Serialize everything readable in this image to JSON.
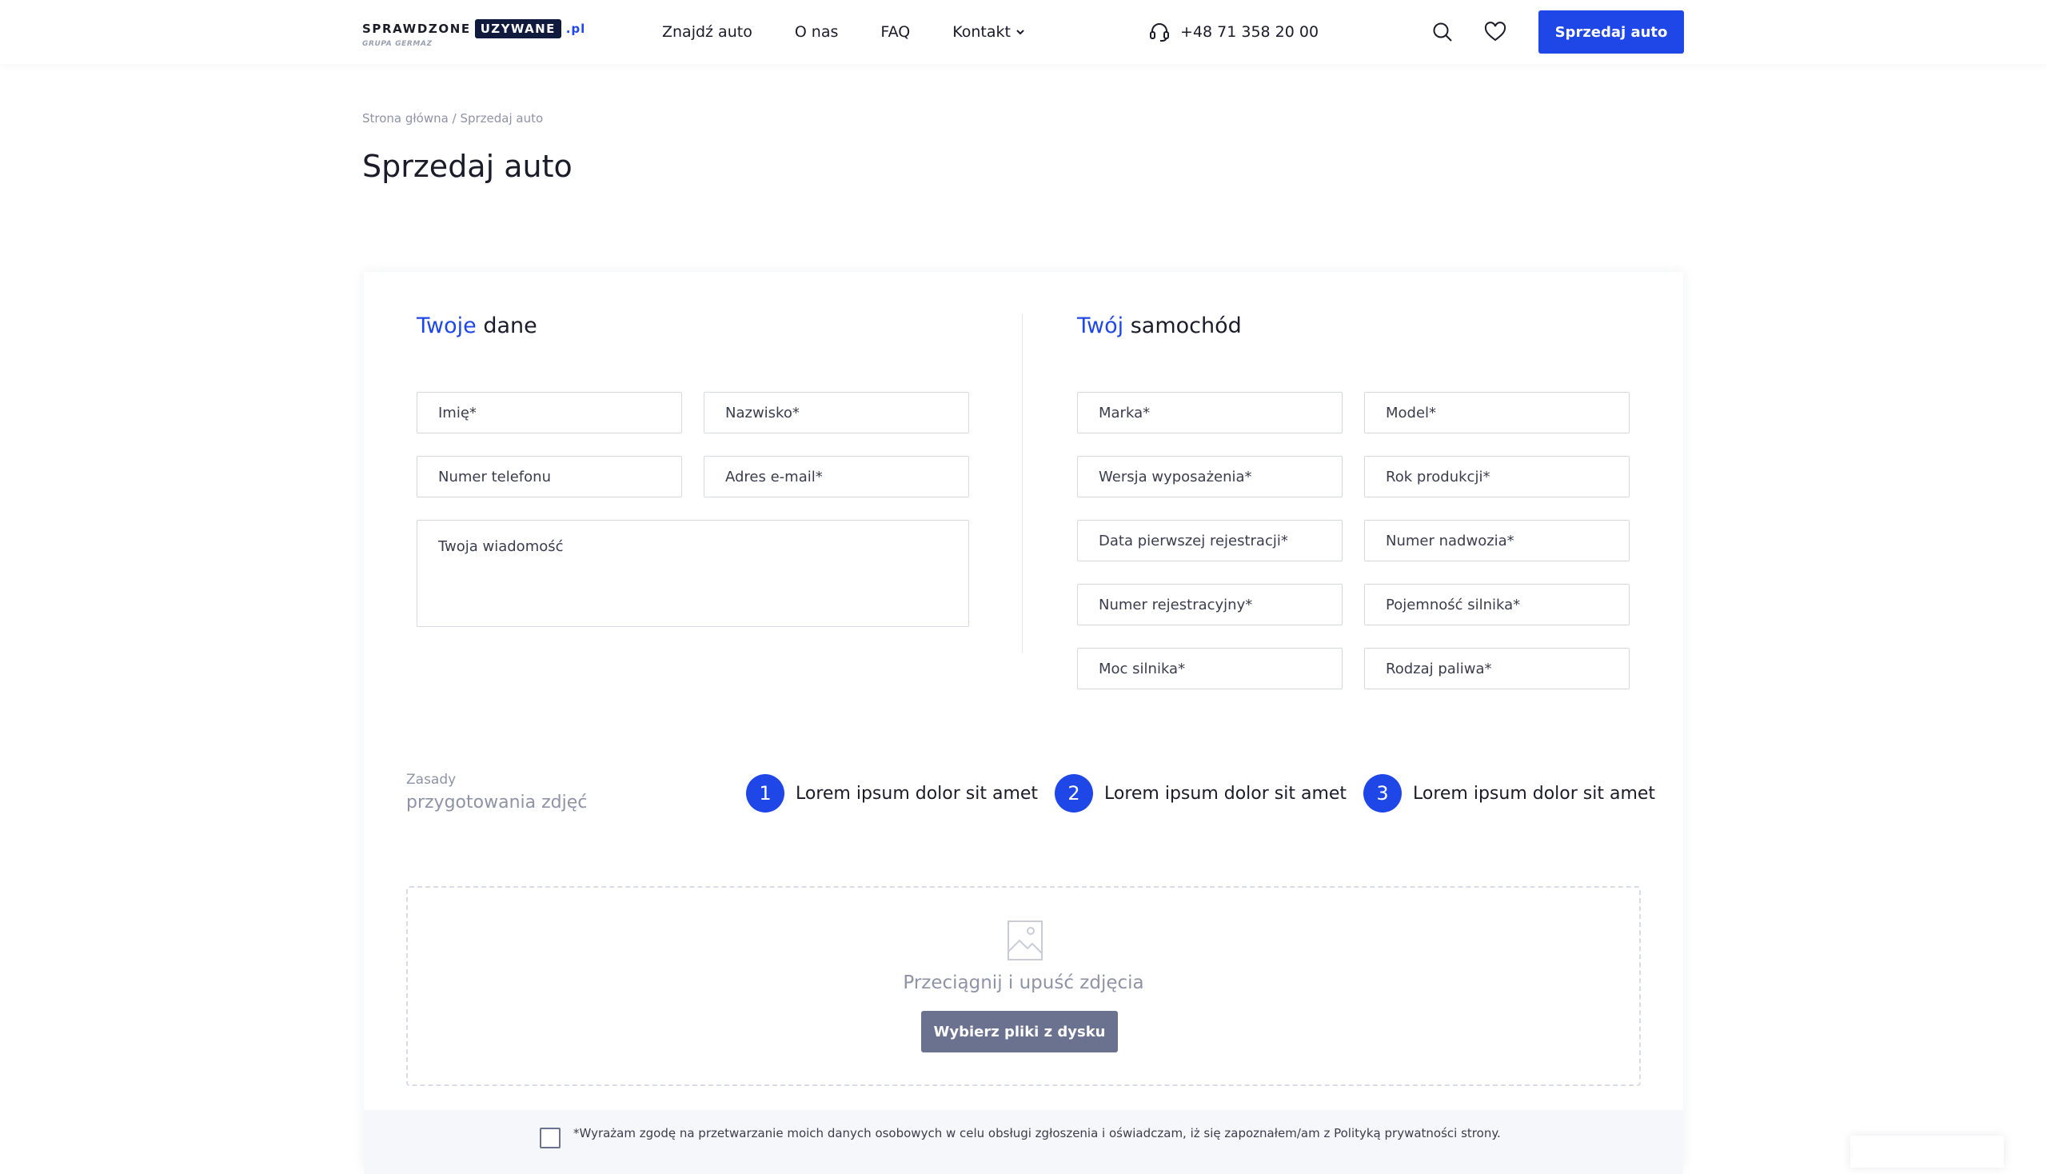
{
  "header": {
    "logo": {
      "word1": "SPRAWDZONE",
      "word2": "UZYWANE",
      "tld": ".pl",
      "sub": "GRUPA GERMAZ"
    },
    "nav": [
      {
        "label": "Znajdź auto"
      },
      {
        "label": "O nas"
      },
      {
        "label": "FAQ"
      },
      {
        "label": "Kontakt",
        "has_dropdown": true
      }
    ],
    "phone": "+48 71 358 20 00",
    "icons": [
      "headset-icon",
      "search-icon",
      "heart-icon"
    ],
    "cta_label": "Sprzedaj auto",
    "accent": "#1f47e8"
  },
  "breadcrumb": {
    "home": "Strona główna",
    "separator": "/",
    "current": "Sprzedaj auto"
  },
  "page_title": "Sprzedaj auto",
  "personal": {
    "title_accent": "Twoje",
    "title_rest": "dane",
    "fields": {
      "first_name": "Imię*",
      "last_name": "Nazwisko*",
      "phone": "Numer telefonu",
      "email": "Adres e-mail*",
      "message": "Twoja wiadomość"
    }
  },
  "car": {
    "title_accent": "Twój",
    "title_rest": "samochód",
    "fields": {
      "make": "Marka*",
      "model": "Model*",
      "trim": "Wersja wyposażenia*",
      "year": "Rok produkcji*",
      "first_registration": "Data pierwszej rejestracji*",
      "vin": "Numer nadwozia*",
      "plate": "Numer rejestracyjny*",
      "engine_capacity": "Pojemność silnika*",
      "engine_power": "Moc silnika*",
      "fuel": "Rodzaj paliwa*"
    }
  },
  "photo_rules": {
    "label_line1": "Zasady",
    "label_line2": "przygotowania zdjęć",
    "steps": [
      {
        "num": "1",
        "text": "Lorem ipsum dolor sit amet"
      },
      {
        "num": "2",
        "text": "Lorem ipsum dolor sit amet"
      },
      {
        "num": "3",
        "text": "Lorem ipsum dolor sit amet"
      }
    ]
  },
  "dropzone": {
    "text": "Przeciągnij i upuść zdjęcia",
    "button": "Wybierz pliki z dysku"
  },
  "consent": {
    "text": "*Wyrażam zgodę na przetwarzanie moich danych osobowych w celu obsługi zgłoszenia i oświadczam, iż się zapoznałem/am z Polityką prywatności strony."
  }
}
